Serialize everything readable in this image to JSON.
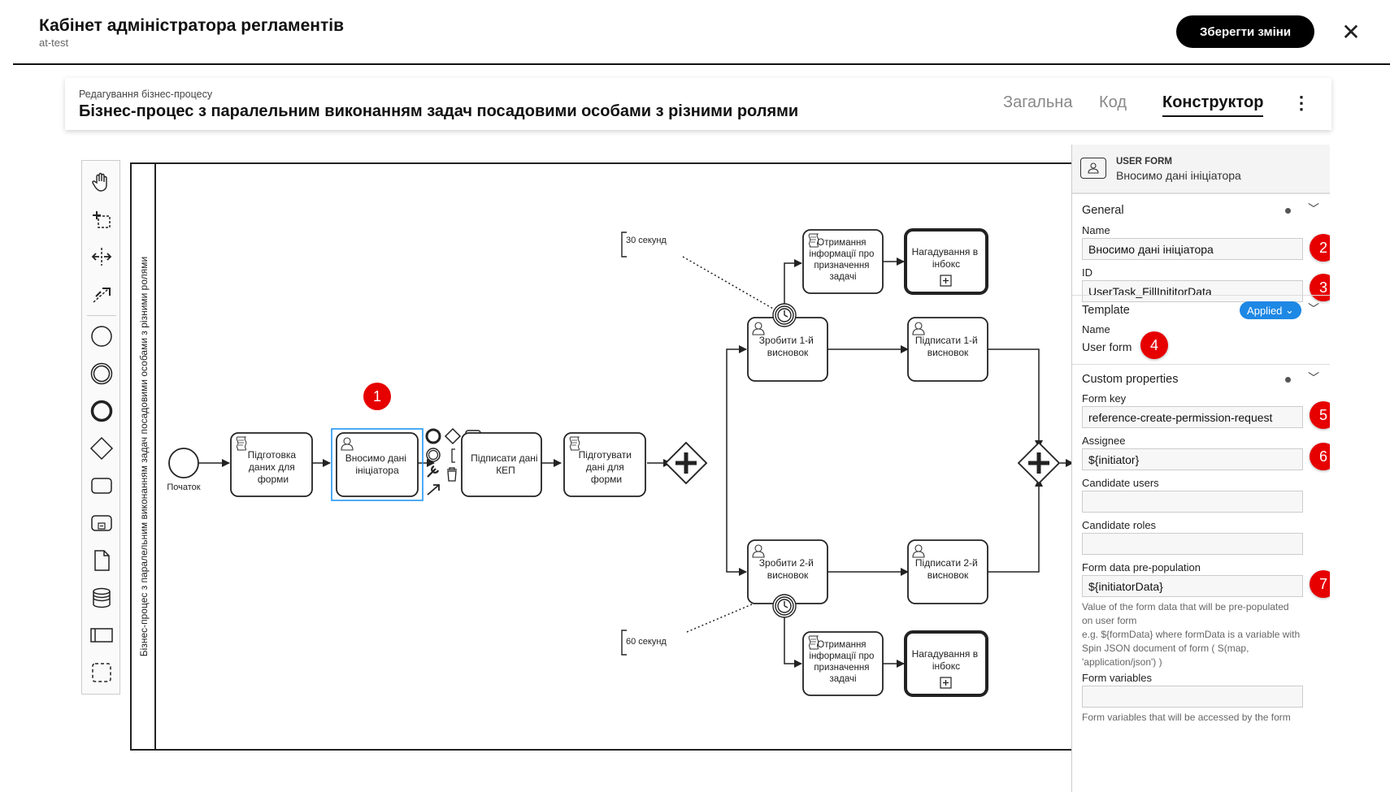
{
  "header": {
    "title": "Кабінет адміністратора регламентів",
    "subtitle": "at-test",
    "save_label": "Зберегти зміни",
    "close_glyph": "✕"
  },
  "card": {
    "subtitle": "Редагування бізнес-процесу",
    "title": "Бізнес-процес з паралельним виконанням задач посадовими особами з різними ролями",
    "tabs": [
      {
        "label": "Загальна",
        "active": false
      },
      {
        "label": "Код",
        "active": false
      },
      {
        "label": "Конструктор",
        "active": true
      }
    ],
    "menu_glyph": "⋮"
  },
  "palette": {
    "tools": [
      "hand-tool",
      "lasso-tool",
      "space-tool",
      "connect-tool"
    ],
    "shapes": [
      "start-event",
      "intermediate-event",
      "end-event",
      "gateway",
      "task",
      "subprocess",
      "data-object",
      "data-store",
      "pool",
      "group"
    ]
  },
  "diagram": {
    "pool_label": "Бізнес-процес з паралельним виконанням задач посадовими особами з різними ролями",
    "start_label": "Початок",
    "timer_top": "30 секунд",
    "timer_bottom": "60 секунд",
    "tasks": {
      "prepare": [
        "Підготовка",
        "даних для",
        "форми"
      ],
      "enter": [
        "Вносимо дані",
        "ініціатора"
      ],
      "sign": [
        "Підписати дані",
        "КЕП"
      ],
      "prepare2": [
        "Підготувати",
        "дані для",
        "форми"
      ],
      "make1": [
        "Зробити 1-й",
        "висновок"
      ],
      "sign1": [
        "Підписати 1-й",
        "висновок"
      ],
      "make2": [
        "Зробити 2-й",
        "висновок"
      ],
      "sign2": [
        "Підписати 2-й",
        "висновок"
      ],
      "info1": [
        "Отримання",
        "інформації про",
        "призначення",
        "задачі"
      ],
      "info2": [
        "Отримання",
        "інформації про",
        "призначення",
        "задачі"
      ],
      "remind1": [
        "Нагадування в",
        "інбокс"
      ],
      "remind2": [
        "Нагадування в",
        "інбокс"
      ]
    },
    "badge_1": "1"
  },
  "panel": {
    "type": "USER FORM",
    "name": "Вносимо дані ініціатора",
    "general": {
      "title": "General",
      "name_label": "Name",
      "name_value": "Вносимо дані ініціатора",
      "id_label": "ID",
      "id_value": "UserTask_FillInititorData"
    },
    "template": {
      "title": "Template",
      "badge": "Applied",
      "name_label": "Name",
      "name_value": "User form"
    },
    "custom": {
      "title": "Custom properties",
      "form_key_label": "Form key",
      "form_key_value": "reference-create-permission-request",
      "assignee_label": "Assignee",
      "assignee_value": "${initiator}",
      "cand_users_label": "Candidate users",
      "cand_users_value": "",
      "cand_roles_label": "Candidate roles",
      "cand_roles_value": "",
      "prepop_label": "Form data pre-population",
      "prepop_value": "${initiatorData}",
      "prepop_desc_1": "Value of the form data that will be pre-populated on user form",
      "prepop_desc_2": "e.g. ${formData} where formData is a variable with Spin JSON document of form ( S(map, 'application/json') )",
      "form_vars_label": "Form variables",
      "form_vars_value": "",
      "form_vars_desc": "Form variables that will be accessed by the form"
    },
    "badges": [
      "2",
      "3",
      "4",
      "5",
      "6",
      "7"
    ]
  }
}
